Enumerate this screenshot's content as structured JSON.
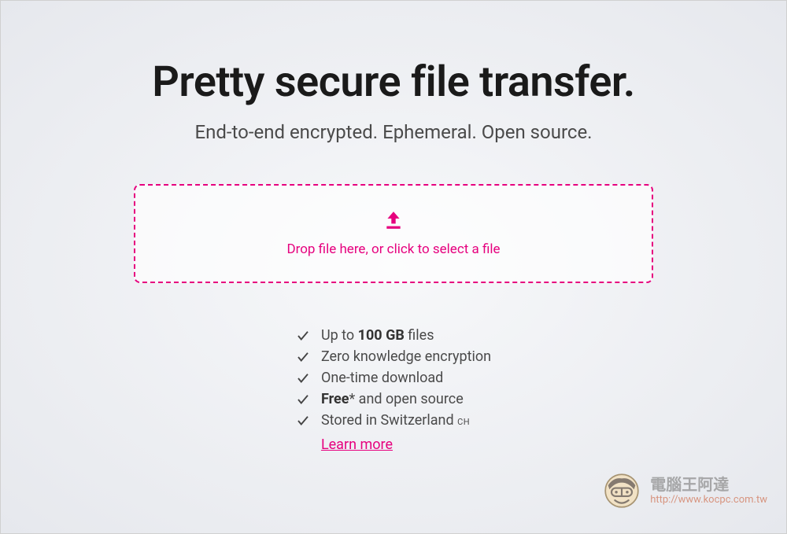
{
  "hero": {
    "headline": "Pretty secure file transfer.",
    "subheadline": "End-to-end encrypted. Ephemeral. Open source."
  },
  "dropzone": {
    "text": "Drop file here, or click to select a file"
  },
  "features": {
    "items": [
      {
        "html": "Up to <strong>100 GB</strong> files"
      },
      {
        "html": "Zero knowledge encryption"
      },
      {
        "html": "One-time download"
      },
      {
        "html": "<strong>Free</strong>* and open source"
      },
      {
        "html": "Stored in Switzerland <small>CH</small>"
      }
    ],
    "learn_more": "Learn more"
  },
  "watermark": {
    "title": "電腦王阿達",
    "url": "http://www.kocpc.com.tw"
  },
  "colors": {
    "accent": "#e6007e"
  }
}
